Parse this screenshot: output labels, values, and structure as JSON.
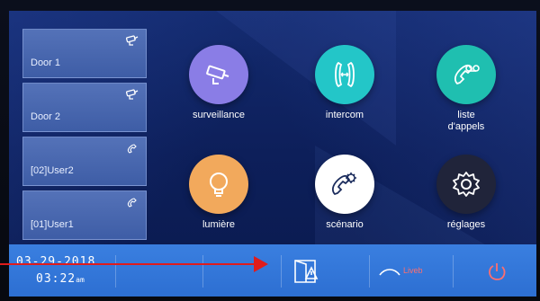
{
  "side_list": {
    "items": [
      {
        "label": "Door 1",
        "icon": "camera-icon"
      },
      {
        "label": "Door 2",
        "icon": "camera-icon"
      },
      {
        "label": "[02]User2",
        "icon": "phone-handset-icon"
      },
      {
        "label": "[01]User1",
        "icon": "phone-handset-icon"
      }
    ]
  },
  "apps": [
    {
      "label": "surveillance",
      "icon": "cctv-camera-icon",
      "color": "#8a7de6"
    },
    {
      "label": "intercom",
      "icon": "intercom-icon",
      "color": "#23c6c8"
    },
    {
      "label": "liste\nd'appels",
      "line1": "liste",
      "line2": "d'appels",
      "icon": "call-log-icon",
      "color": "#1fbfb0"
    },
    {
      "label": "lumière",
      "icon": "light-bulb-icon",
      "color": "#f2a95c"
    },
    {
      "label": "scénario",
      "icon": "scenario-phone-gear-icon",
      "color": "#ffffff"
    },
    {
      "label": "réglages",
      "icon": "gear-icon",
      "color": "#20243a"
    }
  ],
  "status_bar": {
    "date": "03-29-2018",
    "time": "03:22",
    "ampm": "am",
    "wifi_label": "Liveb",
    "alarm_icon": "door-alarm-icon",
    "power_icon": "power-icon",
    "accent": "#2d6fd2"
  },
  "annotation": {
    "color": "#e01c1c"
  }
}
